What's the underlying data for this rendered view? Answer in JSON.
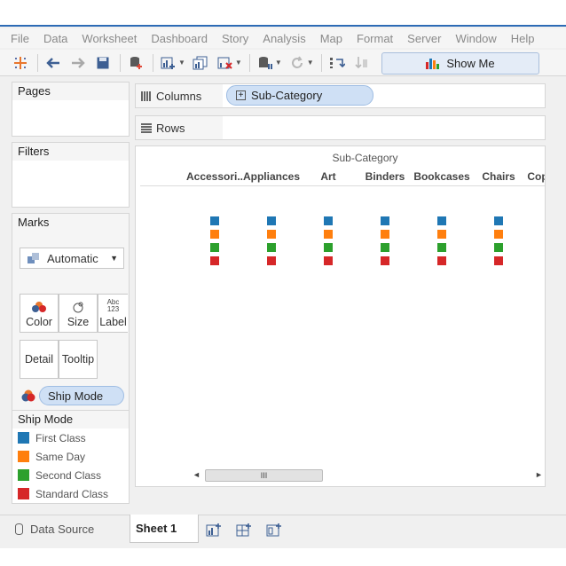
{
  "menu": [
    "File",
    "Data",
    "Worksheet",
    "Dashboard",
    "Story",
    "Analysis",
    "Map",
    "Format",
    "Server",
    "Window",
    "Help"
  ],
  "toolbar": {
    "show_me_label": "Show Me",
    "icons": [
      "tableau-logo-icon",
      "undo-icon",
      "redo-icon",
      "save-icon",
      "new-data-source-icon",
      "new-worksheet-icon",
      "duplicate-sheet-icon",
      "clear-sheet-icon",
      "pause-updates-icon",
      "refresh-icon",
      "swap-icon",
      "sort-icon"
    ]
  },
  "panes": {
    "pages": "Pages",
    "filters": "Filters",
    "marks": "Marks",
    "mark_type": "Automatic"
  },
  "mark_cards": {
    "color": "Color",
    "size": "Size",
    "label": "Label",
    "label_icon_text": "Abc 123",
    "detail": "Detail",
    "tooltip": "Tooltip"
  },
  "marks_field": "Ship Mode",
  "shelves": {
    "columns_label": "Columns",
    "rows_label": "Rows",
    "columns_field": "Sub-Category"
  },
  "legend": {
    "title": "Ship Mode",
    "items": [
      {
        "label": "First Class",
        "color": "#1f77b4"
      },
      {
        "label": "Same Day",
        "color": "#ff7f0e"
      },
      {
        "label": "Second Class",
        "color": "#2ca02c"
      },
      {
        "label": "Standard Class",
        "color": "#d62728"
      }
    ]
  },
  "viz": {
    "header": "Sub-Category",
    "categories": [
      "Accessori..",
      "Appliances",
      "Art",
      "Binders",
      "Bookcases",
      "Chairs",
      "Cop"
    ],
    "marks_per_category": 4,
    "scroll_thumb_glyph": "III"
  },
  "tabs": {
    "data_source": "Data Source",
    "sheet": "Sheet 1"
  }
}
